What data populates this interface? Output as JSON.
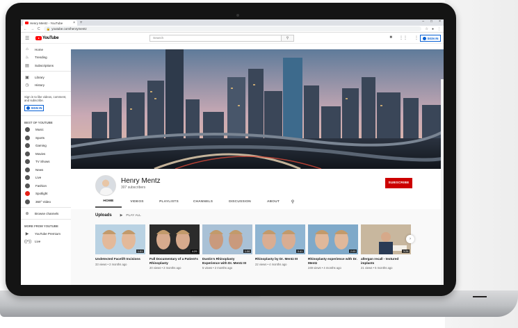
{
  "browser": {
    "tab_title": "Henry Mentz - YouTube",
    "tab_close": "×",
    "new_tab": "+",
    "window_controls": [
      "–",
      "□",
      "×"
    ],
    "nav": [
      "←",
      "→",
      "C"
    ],
    "url": "youtube.com/henrymentz"
  },
  "header": {
    "menu_icon": "☰",
    "logo_text": "YouTube",
    "search_placeholder": "Search",
    "search_icon": "⚲",
    "icons": [
      "camera-icon",
      "apps-icon",
      "more-icon"
    ],
    "icon_glyphs": [
      "■",
      "⋮⋮",
      "⋮"
    ],
    "sign_in": "SIGN IN"
  },
  "sidebar": {
    "top_items": [
      {
        "icon": "home-icon",
        "glyph": "⌂",
        "label": "Home"
      },
      {
        "icon": "trending-icon",
        "glyph": "♨",
        "label": "Trending"
      },
      {
        "icon": "subscriptions-icon",
        "glyph": "▤",
        "label": "Subscriptions"
      }
    ],
    "library_items": [
      {
        "icon": "library-icon",
        "glyph": "▣",
        "label": "Library"
      },
      {
        "icon": "history-icon",
        "glyph": "◷",
        "label": "History"
      }
    ],
    "signin_prompt": "Sign in to like videos, comment, and subscribe.",
    "signin_button": "SIGN IN",
    "best_heading": "BEST OF YOUTUBE",
    "categories": [
      "Music",
      "Sports",
      "Gaming",
      "Movies",
      "TV Shows",
      "News",
      "Live",
      "Fashion",
      "Spotlight",
      "360° Video"
    ],
    "browse_channels": "Browse channels",
    "more_heading": "MORE FROM YOUTUBE",
    "more_items": [
      {
        "icon": "youtube-premium-icon",
        "glyph": "▶",
        "label": "YouTube Premium"
      },
      {
        "icon": "live-icon",
        "glyph": "((•))",
        "label": "Live"
      }
    ]
  },
  "channel": {
    "name": "Henry Mentz",
    "subscribers": "307 subscribers",
    "subscribe": "SUBSCRIBE",
    "tabs": [
      "HOME",
      "VIDEOS",
      "PLAYLISTS",
      "CHANNELS",
      "DISCUSSION",
      "ABOUT"
    ],
    "search_icon": "⚲"
  },
  "uploads": {
    "title": "Uploads",
    "play_all": "PLAY ALL",
    "next": "›",
    "videos": [
      {
        "title": "Undetected Facelift Incisions",
        "meta": "33 views • 2 months ago",
        "duration": "1:01"
      },
      {
        "title": "Full Documentary of a Patient's Rhinoplasty",
        "meta": "20 views • 2 months ago",
        "duration": "4:29"
      },
      {
        "title": "Dustin's Rhinoplasty Experience with Dr. Mentz III",
        "meta": "5 views • 2 months ago",
        "duration": "1:06"
      },
      {
        "title": "Rhinoplasty by Dr. Mentz III",
        "meta": "22 views • 4 months ago",
        "duration": "0:41"
      },
      {
        "title": "Rhinoplasty experience with Dr. Mentz",
        "meta": "249 views • 4 months ago",
        "duration": "2:05"
      },
      {
        "title": "allergan recall - textured implants",
        "meta": "21 views • 5 months ago",
        "duration": "3:28"
      }
    ]
  },
  "colors": {
    "brand_red": "#ff0000",
    "subscribe_red": "#cc0000",
    "link_blue": "#065fd4"
  }
}
